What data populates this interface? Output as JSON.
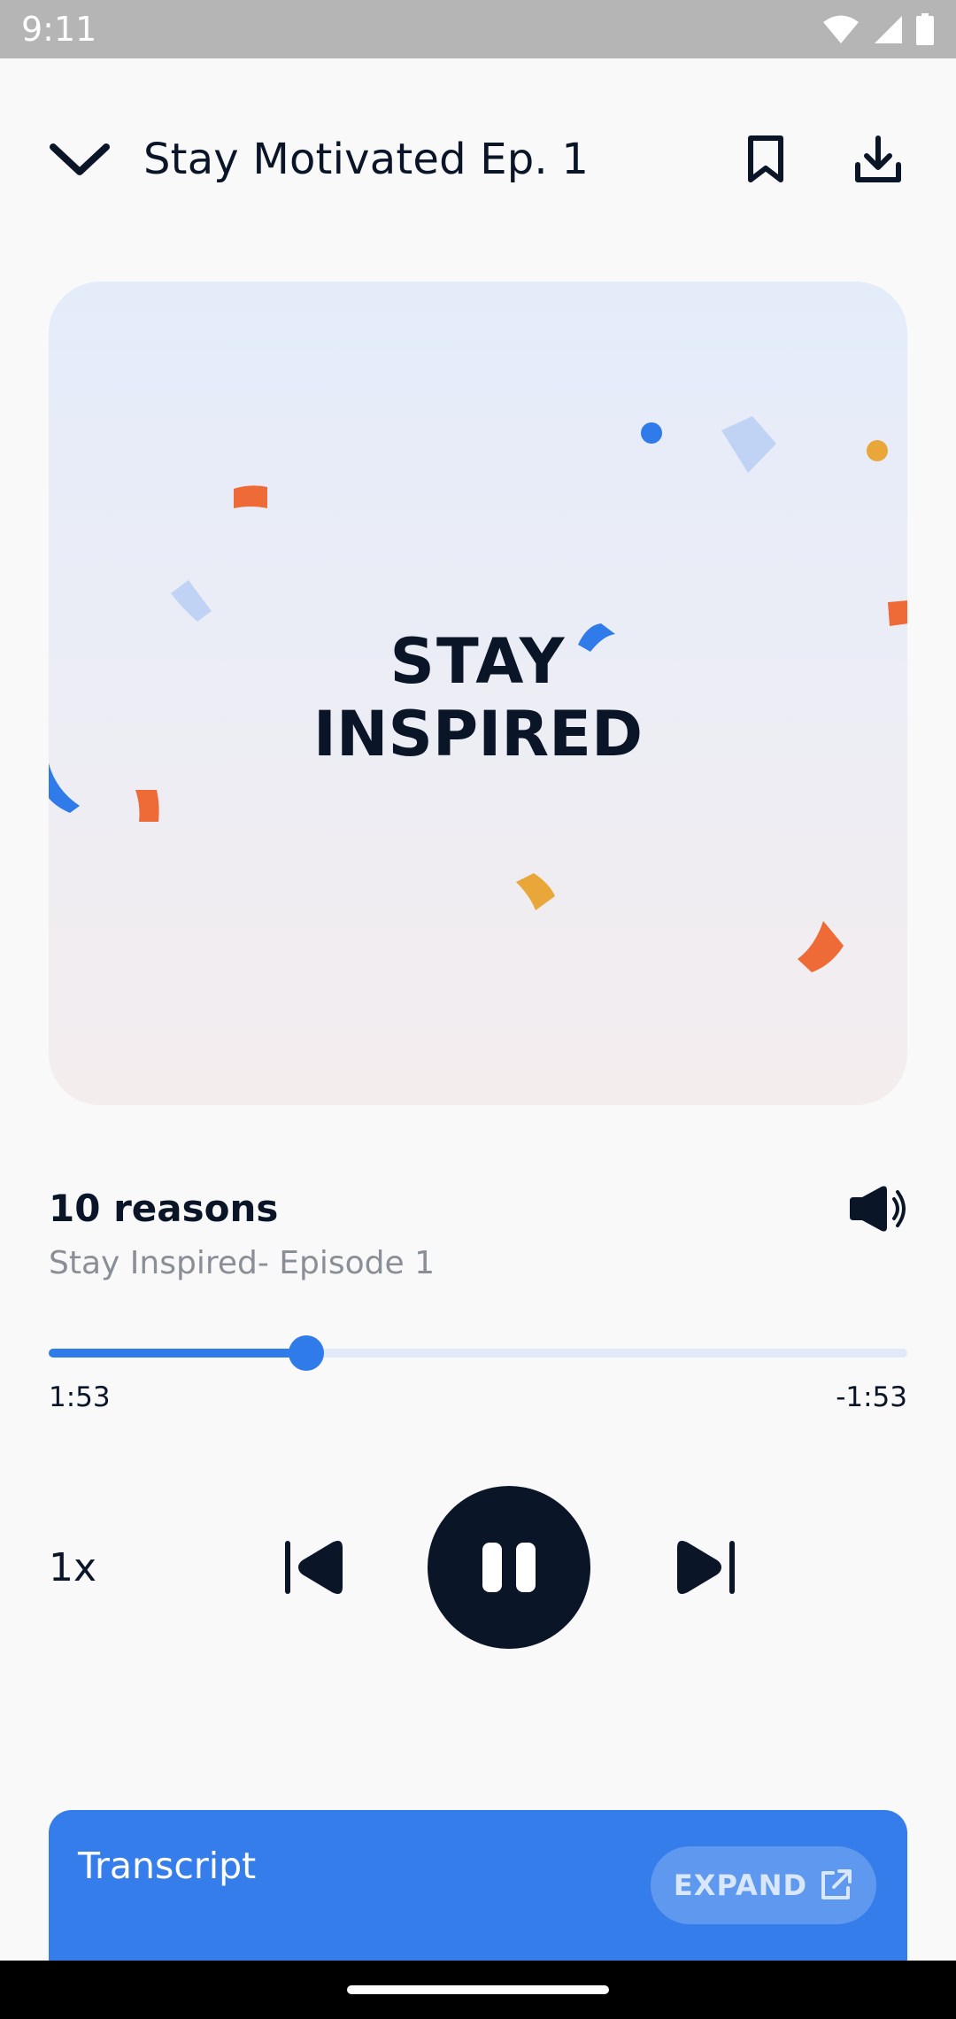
{
  "status_bar": {
    "time": "9:11"
  },
  "header": {
    "title": "Stay Motivated Ep. 1"
  },
  "cover": {
    "line1": "STAY",
    "line2": "INSPIRED"
  },
  "track": {
    "title": "10 reasons",
    "subtitle": "Stay Inspired- Episode 1"
  },
  "player": {
    "elapsed": "1:53",
    "remaining": "-1:53",
    "progress_fraction": 0.3,
    "speed": "1x",
    "state": "playing"
  },
  "transcript": {
    "label": "Transcript",
    "expand_label": "EXPAND"
  },
  "colors": {
    "accent": "#2F7BEA",
    "dark": "#0B1528",
    "orange": "#EE6A37",
    "yellow": "#E9A73A",
    "light_blue": "#C0D3F5"
  },
  "icons": {
    "collapse": "chevron-down-icon",
    "bookmark": "bookmark-icon",
    "download": "download-icon",
    "volume": "volume-icon",
    "previous": "skip-previous-icon",
    "pause": "pause-icon",
    "next": "skip-next-icon",
    "expand": "external-link-icon"
  }
}
